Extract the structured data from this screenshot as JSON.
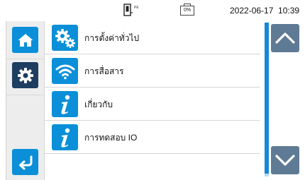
{
  "status": {
    "plug_icon": "plug-pe-icon",
    "pe_label": "PE",
    "battery_level": "0%",
    "datetime": "2022-06-17  10:39"
  },
  "sidebar": {
    "home": {
      "icon": "home-icon"
    },
    "settings": {
      "icon": "gear-icon",
      "active": true
    },
    "back": {
      "icon": "return-arrow-icon"
    }
  },
  "menu": {
    "items": [
      {
        "label": "การตั้งค่าทั่วไป",
        "icon": "gears-icon"
      },
      {
        "label": "การสื่อสาร",
        "icon": "wifi-icon"
      },
      {
        "label": "เกี่ยวกับ",
        "icon": "info-icon"
      },
      {
        "label": "การทดสอบ IO",
        "icon": "info-icon"
      }
    ]
  },
  "scroll": {
    "up_icon": "chevron-up-icon",
    "down_icon": "chevron-down-icon",
    "position": 0
  },
  "colors": {
    "accent": "#0a8fd8",
    "active": "#1d3d61",
    "scroll_button": "#5f7a95",
    "scroll_thumb": "#1588d6",
    "scroll_track": "#b6dcf2",
    "sidebar_bg": "#ededed"
  }
}
